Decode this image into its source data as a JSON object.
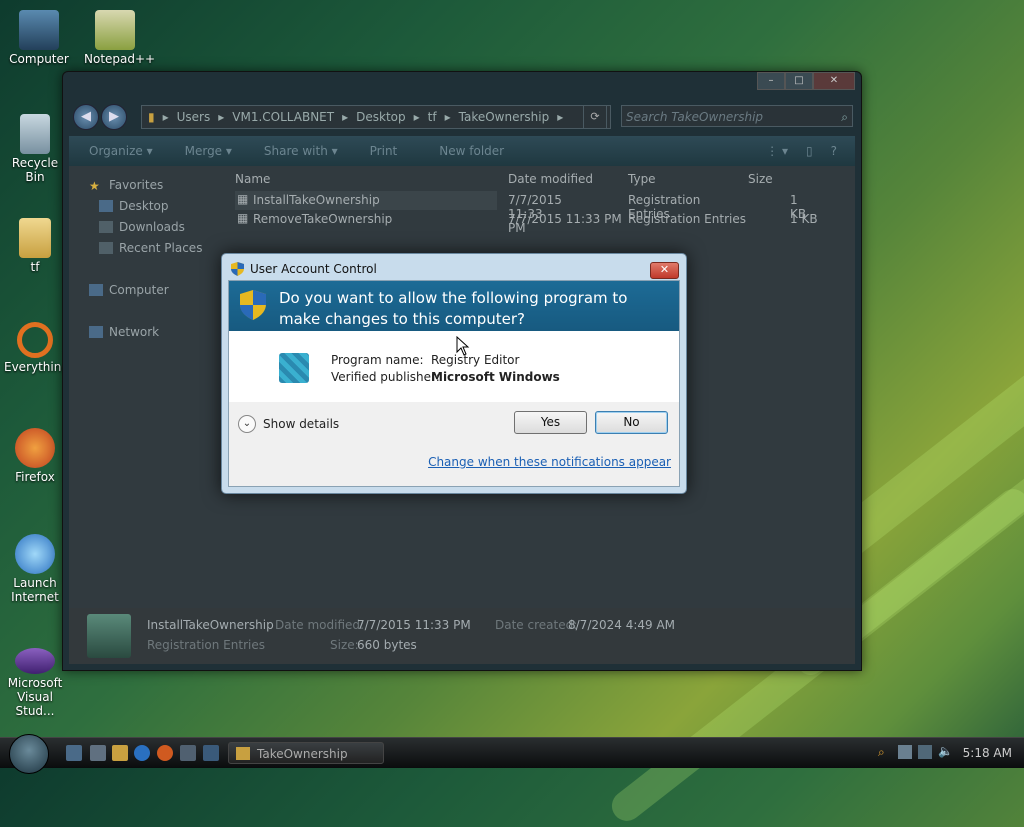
{
  "desktop": {
    "icons": [
      {
        "label": "Computer"
      },
      {
        "label": "Notepad++"
      },
      {
        "label": "Recycle Bin"
      },
      {
        "label": "tf"
      },
      {
        "label": "Everything"
      },
      {
        "label": "Firefox"
      },
      {
        "label": "Launch Internet"
      },
      {
        "label": "Microsoft Visual Stud..."
      }
    ]
  },
  "explorer": {
    "breadcrumb": [
      "Users",
      "VM1.COLLABNET",
      "Desktop",
      "tf",
      "TakeOwnership"
    ],
    "search_placeholder": "Search TakeOwnership",
    "toolbar": {
      "organize": "Organize ▾",
      "merge": "Merge ▾",
      "share_with": "Share with ▾",
      "print": "Print",
      "new_folder": "New folder"
    },
    "nav": {
      "favorites": "Favorites",
      "desktop": "Desktop",
      "downloads": "Downloads",
      "recent": "Recent Places",
      "computer": "Computer",
      "network": "Network"
    },
    "columns": {
      "name": "Name",
      "date": "Date modified",
      "type": "Type",
      "size": "Size"
    },
    "files": [
      {
        "name": "InstallTakeOwnership",
        "date": "7/7/2015 11:33 PM",
        "type": "Registration Entries",
        "size": "1 KB"
      },
      {
        "name": "RemoveTakeOwnership",
        "date": "7/7/2015 11:33 PM",
        "type": "Registration Entries",
        "size": "1 KB"
      }
    ],
    "details": {
      "name": "InstallTakeOwnership",
      "type": "Registration Entries",
      "date_modified_label": "Date modified:",
      "date_modified": "7/7/2015 11:33 PM",
      "date_created_label": "Date created:",
      "date_created": "8/7/2024 4:49 AM",
      "size_label": "Size:",
      "size": "660 bytes"
    }
  },
  "uac": {
    "title": "User Account Control",
    "question": "Do you want to allow the following program to make changes to this computer?",
    "program_label": "Program name:",
    "program_value": "Registry Editor",
    "publisher_label": "Verified publisher:",
    "publisher_value": "Microsoft Windows",
    "show_details": "Show details",
    "yes": "Yes",
    "no": "No",
    "link": "Change when these notifications appear"
  },
  "taskbar": {
    "task_label": "TakeOwnership",
    "clock": "5:18 AM"
  },
  "colors": {
    "banner": "#1d6b96",
    "link": "#1a5fb4"
  }
}
